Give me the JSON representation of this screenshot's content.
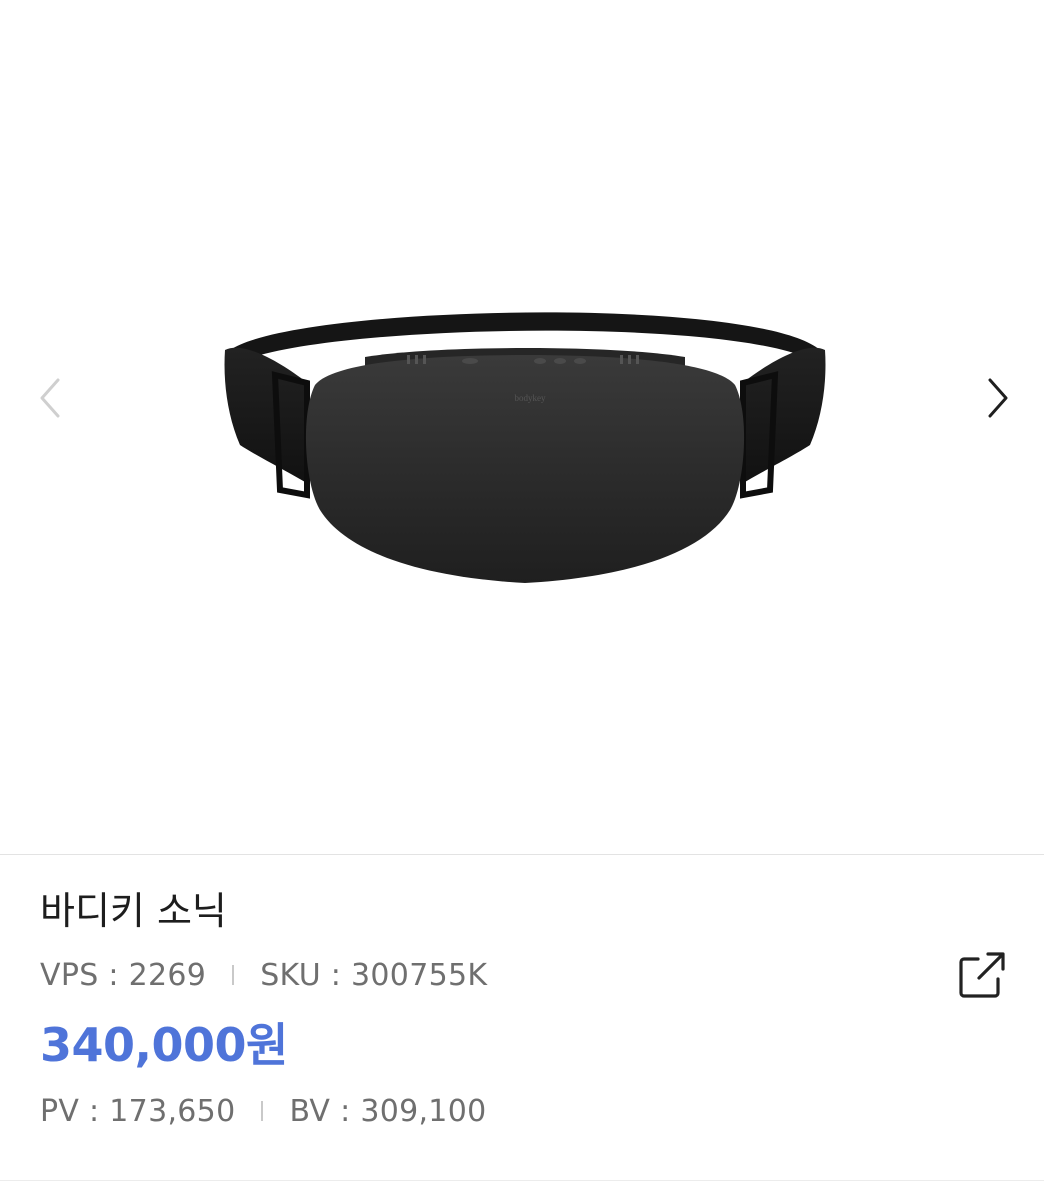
{
  "gallery": {
    "image": {
      "icon": "waist-massager-belt-image",
      "brand_mark": "bodykey"
    },
    "prev_icon": "chevron-left-icon",
    "next_icon": "chevron-right-icon"
  },
  "product": {
    "title": "바디키 소닉",
    "vps_label": "VPS : 2269",
    "sku_label": "SKU : 300755K",
    "price": "340,000원",
    "pv_label": "PV : 173,650",
    "bv_label": "BV : 309,100",
    "share_icon": "share-external-icon"
  },
  "colors": {
    "price": "#4f74d9",
    "text_primary": "#1d1d1d",
    "text_secondary": "#6f6f6f",
    "product_body": "#2a2a2a"
  }
}
